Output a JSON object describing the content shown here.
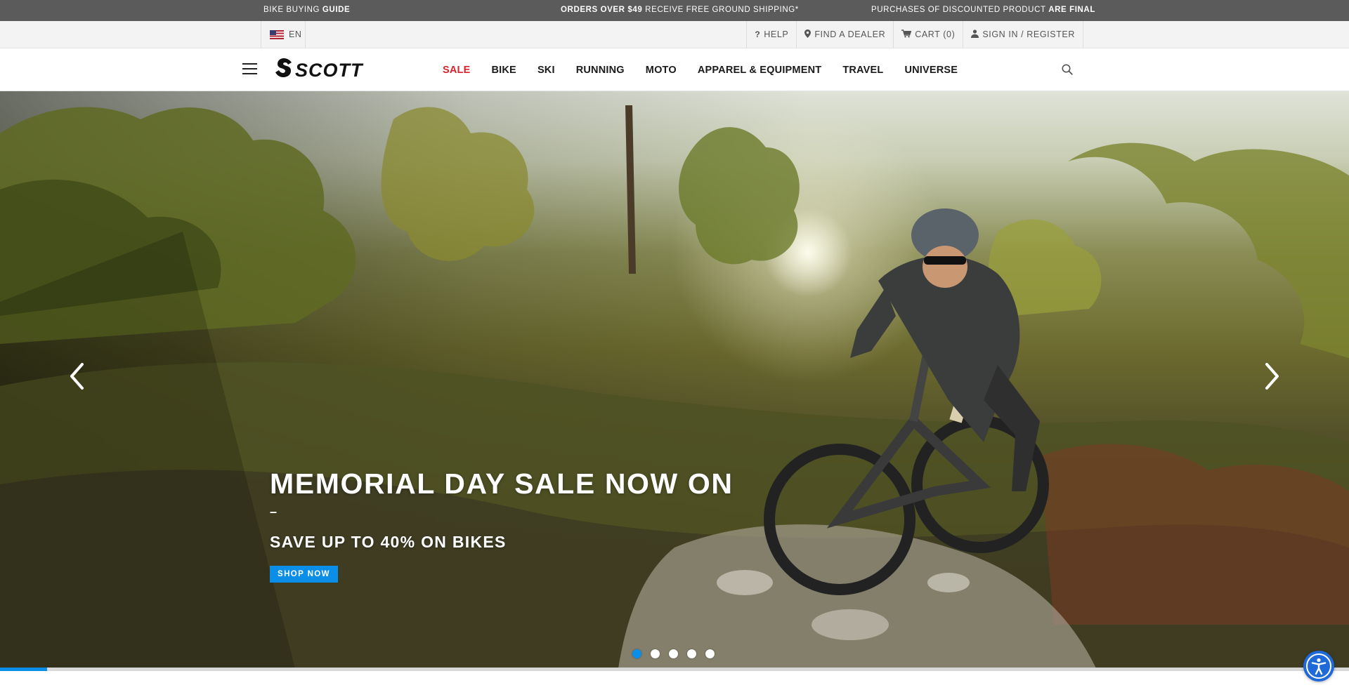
{
  "promo": {
    "left_prefix": "Bike buying ",
    "left_bold": "Guide",
    "center_bold": "Orders over $49",
    "center_rest": " receive free ground shipping*",
    "right_prefix": "Purchases of discounted product ",
    "right_bold": "are final"
  },
  "util": {
    "language": "EN",
    "help": "Help",
    "find_dealer": "Find a Dealer",
    "cart": "Cart (0)",
    "signin": "Sign In / Register"
  },
  "nav": {
    "items": [
      "Sale",
      "Bike",
      "Ski",
      "Running",
      "Moto",
      "Apparel & Equipment",
      "Travel",
      "Universe"
    ]
  },
  "hero": {
    "title": "Memorial Day Sale Now On",
    "dash": "–",
    "subtitle": "Save up to 40% on bikes",
    "cta": "Shop now",
    "active_slide": 1,
    "slide_count": 5,
    "progress": 0.035
  },
  "colors": {
    "accent": "#0a8ee8",
    "sale": "#d9232d",
    "promo_bg": "#5b5b5b",
    "accessibility": "#1f6ad8"
  },
  "icons": [
    "question-icon",
    "map-pin-icon",
    "cart-icon",
    "user-icon",
    "hamburger-icon",
    "search-icon",
    "chevron-left-icon",
    "chevron-right-icon",
    "accessibility-icon"
  ]
}
